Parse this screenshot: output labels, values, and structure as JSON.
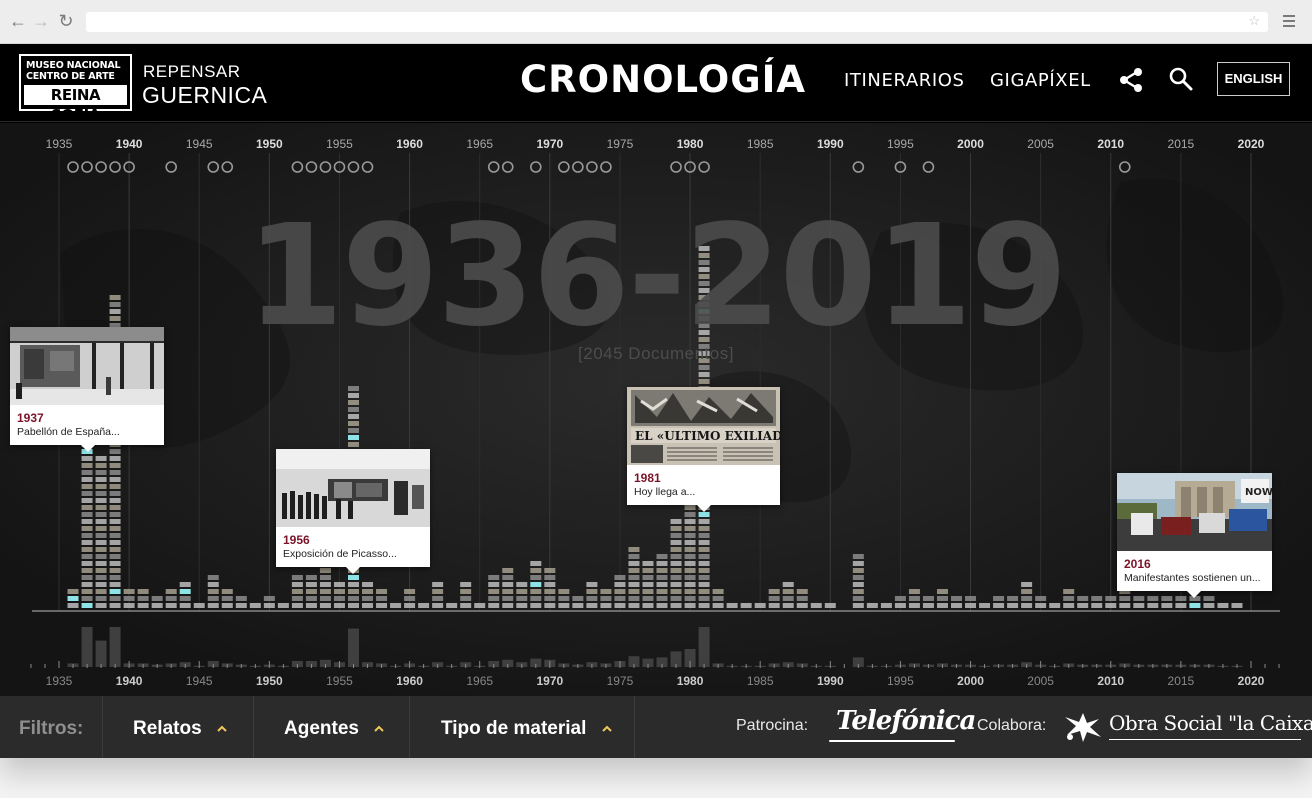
{
  "browser": {
    "back_icon": "back-arrow-icon",
    "forward_icon": "forward-arrow-icon",
    "reload_icon": "reload-icon",
    "url": "",
    "star_icon": "star-icon",
    "menu_icon": "hamburger-menu-icon"
  },
  "header": {
    "logo_line1": "MUSEO NACIONAL",
    "logo_line2": "CENTRO DE ARTE",
    "logo_line3": "REINA SOFIA",
    "subtitle_line1": "REPENSAR",
    "subtitle_line2": "GUERNICA",
    "section_title": "CRONOLOGÍA",
    "nav_itinerarios": "ITINERARIOS",
    "nav_gigapixel": "GIGAPÍXEL",
    "share_icon": "share-icon",
    "search_icon": "search-icon",
    "language_button": "ENGLISH"
  },
  "timeline": {
    "range_label": "1936-2019",
    "document_count_label": "[2045 Documentos]",
    "axis_labels": [
      "1935",
      "1940",
      "1945",
      "1950",
      "1955",
      "1960",
      "1965",
      "1970",
      "1975",
      "1980",
      "1985",
      "1990",
      "1995",
      "2000",
      "2005",
      "2010",
      "2015",
      "2020"
    ],
    "bold_axis_labels": [
      "1940",
      "1950",
      "1960",
      "1970",
      "1980",
      "1990",
      "2000",
      "2010",
      "2020"
    ],
    "year_range": [
      1935,
      2020
    ],
    "marker_years": [
      1936,
      1937,
      1938,
      1939,
      1940,
      1943,
      1946,
      1947,
      1952,
      1953,
      1954,
      1955,
      1956,
      1957,
      1966,
      1967,
      1969,
      1971,
      1972,
      1973,
      1974,
      1979,
      1980,
      1981,
      1992,
      1995,
      1997,
      2011
    ],
    "doc_counts": [
      {
        "year": 1936,
        "count": 3
      },
      {
        "year": 1937,
        "count": 38
      },
      {
        "year": 1938,
        "count": 22
      },
      {
        "year": 1939,
        "count": 45
      },
      {
        "year": 1940,
        "count": 3
      },
      {
        "year": 1941,
        "count": 3
      },
      {
        "year": 1942,
        "count": 2
      },
      {
        "year": 1943,
        "count": 3
      },
      {
        "year": 1944,
        "count": 4
      },
      {
        "year": 1945,
        "count": 1
      },
      {
        "year": 1946,
        "count": 5
      },
      {
        "year": 1947,
        "count": 3
      },
      {
        "year": 1948,
        "count": 2
      },
      {
        "year": 1949,
        "count": 1
      },
      {
        "year": 1950,
        "count": 2
      },
      {
        "year": 1951,
        "count": 1
      },
      {
        "year": 1952,
        "count": 5
      },
      {
        "year": 1953,
        "count": 5
      },
      {
        "year": 1954,
        "count": 6
      },
      {
        "year": 1955,
        "count": 4
      },
      {
        "year": 1956,
        "count": 32
      },
      {
        "year": 1957,
        "count": 4
      },
      {
        "year": 1958,
        "count": 3
      },
      {
        "year": 1959,
        "count": 1
      },
      {
        "year": 1960,
        "count": 3
      },
      {
        "year": 1961,
        "count": 1
      },
      {
        "year": 1962,
        "count": 4
      },
      {
        "year": 1963,
        "count": 1
      },
      {
        "year": 1964,
        "count": 4
      },
      {
        "year": 1965,
        "count": 1
      },
      {
        "year": 1966,
        "count": 5
      },
      {
        "year": 1967,
        "count": 6
      },
      {
        "year": 1968,
        "count": 4
      },
      {
        "year": 1969,
        "count": 7
      },
      {
        "year": 1970,
        "count": 6
      },
      {
        "year": 1971,
        "count": 3
      },
      {
        "year": 1972,
        "count": 2
      },
      {
        "year": 1973,
        "count": 4
      },
      {
        "year": 1974,
        "count": 3
      },
      {
        "year": 1975,
        "count": 5
      },
      {
        "year": 1976,
        "count": 9
      },
      {
        "year": 1977,
        "count": 7
      },
      {
        "year": 1978,
        "count": 8
      },
      {
        "year": 1979,
        "count": 13
      },
      {
        "year": 1980,
        "count": 15
      },
      {
        "year": 1981,
        "count": 52
      },
      {
        "year": 1982,
        "count": 3
      },
      {
        "year": 1983,
        "count": 1
      },
      {
        "year": 1984,
        "count": 1
      },
      {
        "year": 1985,
        "count": 1
      },
      {
        "year": 1986,
        "count": 3
      },
      {
        "year": 1987,
        "count": 4
      },
      {
        "year": 1988,
        "count": 3
      },
      {
        "year": 1989,
        "count": 1
      },
      {
        "year": 1990,
        "count": 1
      },
      {
        "year": 1991,
        "count": 0
      },
      {
        "year": 1992,
        "count": 8
      },
      {
        "year": 1993,
        "count": 1
      },
      {
        "year": 1994,
        "count": 1
      },
      {
        "year": 1995,
        "count": 2
      },
      {
        "year": 1996,
        "count": 3
      },
      {
        "year": 1997,
        "count": 2
      },
      {
        "year": 1998,
        "count": 3
      },
      {
        "year": 1999,
        "count": 2
      },
      {
        "year": 2000,
        "count": 2
      },
      {
        "year": 2001,
        "count": 1
      },
      {
        "year": 2002,
        "count": 2
      },
      {
        "year": 2003,
        "count": 2
      },
      {
        "year": 2004,
        "count": 4
      },
      {
        "year": 2005,
        "count": 2
      },
      {
        "year": 2006,
        "count": 1
      },
      {
        "year": 2007,
        "count": 3
      },
      {
        "year": 2008,
        "count": 2
      },
      {
        "year": 2009,
        "count": 2
      },
      {
        "year": 2010,
        "count": 2
      },
      {
        "year": 2011,
        "count": 3
      },
      {
        "year": 2012,
        "count": 2
      },
      {
        "year": 2013,
        "count": 2
      },
      {
        "year": 2014,
        "count": 2
      },
      {
        "year": 2015,
        "count": 2
      },
      {
        "year": 2016,
        "count": 2
      },
      {
        "year": 2017,
        "count": 2
      },
      {
        "year": 2018,
        "count": 1
      },
      {
        "year": 2019,
        "count": 1
      }
    ]
  },
  "cards": [
    {
      "year": "1937",
      "title": "Pabellón de España...",
      "image": "pavilion-photo"
    },
    {
      "year": "1956",
      "title": "Exposición de Picasso...",
      "image": "exhibition-photo"
    },
    {
      "year": "1981",
      "title": "Hoy llega a...",
      "image": "newspaper-photo"
    },
    {
      "year": "2016",
      "title": "Manifestantes sostienen un...",
      "image": "protest-photo"
    }
  ],
  "footer": {
    "filters_label": "Filtros:",
    "filter_relatos": "Relatos",
    "filter_agentes": "Agentes",
    "filter_tipo": "Tipo de material",
    "chevron_icon": "chevron-up-icon",
    "patrocina_label": "Patrocina:",
    "sponsor_logo": "Telefonica",
    "colabora_label": "Colabora:",
    "collaborator_logo": "Obra Social \"la Caixa\""
  },
  "colors": {
    "accent": "#8de3e6",
    "card_year": "#7a1428",
    "bar_light": "#d8d8d8",
    "background": "#1c1c1c"
  }
}
